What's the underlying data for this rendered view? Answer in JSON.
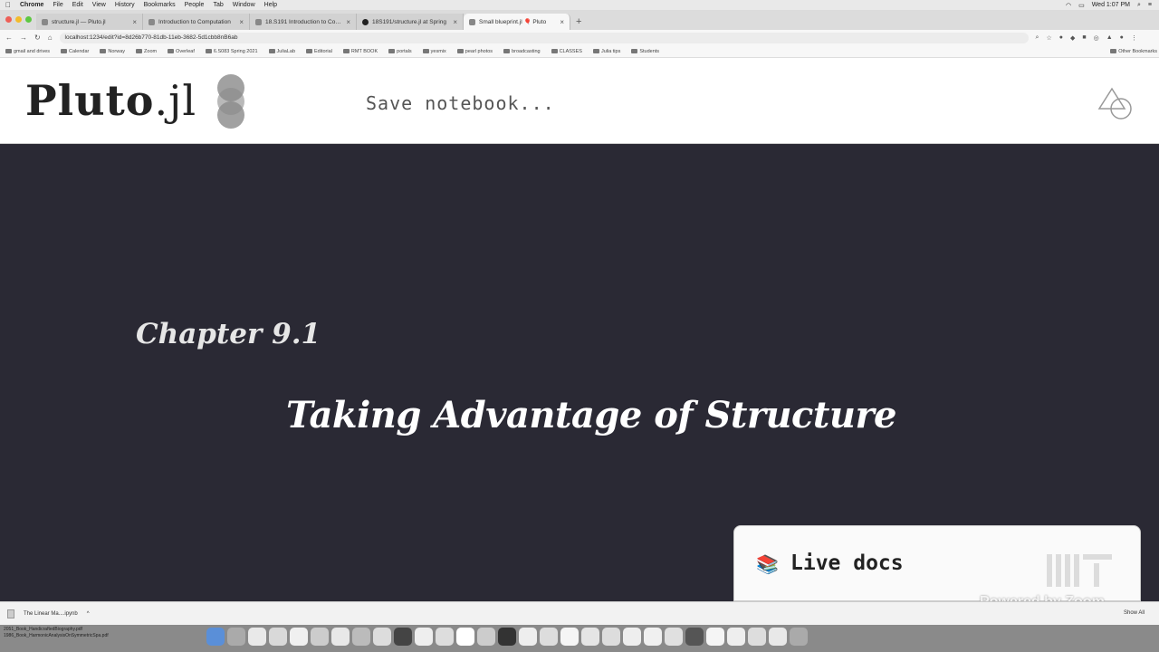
{
  "menubar": {
    "app": "Chrome",
    "items": [
      "File",
      "Edit",
      "View",
      "History",
      "Bookmarks",
      "People",
      "Tab",
      "Window",
      "Help"
    ],
    "clock": "Wed 1:07 PM"
  },
  "tabs": [
    {
      "label": "structure.jl — Pluto.jl",
      "active": false
    },
    {
      "label": "Introduction to Computation",
      "active": false
    },
    {
      "label": "18.S191 Introduction to Comp",
      "active": false
    },
    {
      "label": "18S191/structure.jl at Spring",
      "active": false
    },
    {
      "label": "Small blueprint.jl 🎈 Pluto",
      "active": true
    }
  ],
  "address": {
    "url": "localhost:1234/edit?id=8d26b770-81db-11eb-3682-5d1cbb8nB6ab"
  },
  "bookmarks": [
    "gmail and drives",
    "Calendar",
    "Norway",
    "Zoom",
    "Overleaf",
    "6.S083 Spring 2021",
    "JuliaLab",
    "Editorial",
    "RMT BOOK",
    "portals",
    "yesmix",
    "pearl photos",
    "broadcasting",
    "CLASSES",
    "Julia tips",
    "Students"
  ],
  "bookmarks_other": "Other Bookmarks",
  "pluto": {
    "logo_main": "Pluto",
    "logo_suffix": ".jl",
    "save_label": "Save notebook..."
  },
  "notebook": {
    "chapter": "Chapter 9.1",
    "title": "Taking Advantage of Structure"
  },
  "live_docs": {
    "icon": "📚",
    "label": "Live docs"
  },
  "watermark": "Powered by Zoom",
  "downloads": {
    "file": "The Linear Ma....ipynb",
    "show_all": "Show All"
  },
  "dock_left": {
    "line1": "2051_Book_HandicraftedBiography.pdf",
    "line2": "1986_Book_HarmonicAnalysisOnSymmetricSpa.pdf"
  },
  "colors": {
    "notebook_bg": "#2a2934",
    "header_bg": "#ffffff"
  }
}
